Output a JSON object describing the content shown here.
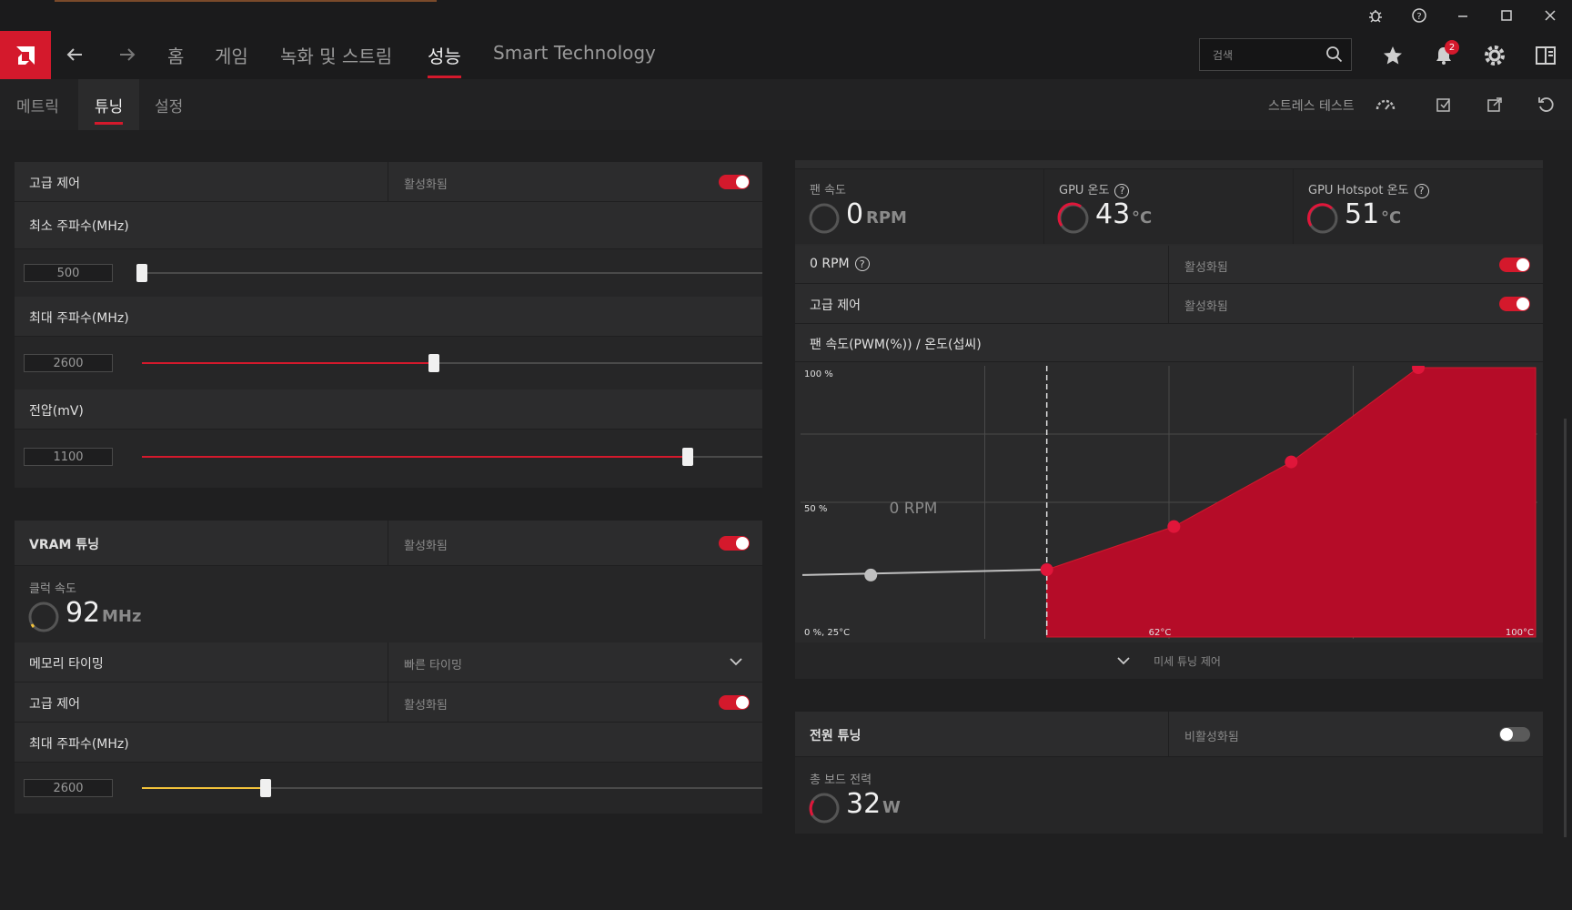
{
  "nav": {
    "home": "홈",
    "gaming": "게임",
    "record": "녹화 및 스트림",
    "performance": "성능",
    "smart": "Smart Technology",
    "search_placeholder": "검색",
    "notification_count": "2"
  },
  "subnav": {
    "metrics": "메트릭",
    "tuning": "튜닝",
    "settings": "설정",
    "stress_test": "스트레스 테스트"
  },
  "gpu_tuning": {
    "advanced_control": "고급 제어",
    "advanced_state": "활성화됨",
    "min_freq_label": "최소 주파수(MHz)",
    "min_freq_value": "500",
    "min_freq_fraction": 0.0,
    "max_freq_label": "최대 주파수(MHz)",
    "max_freq_value": "2600",
    "max_freq_fraction": 0.47,
    "voltage_label": "전압(mV)",
    "voltage_value": "1100",
    "voltage_fraction": 0.88
  },
  "vram": {
    "title": "VRAM 튜닝",
    "state": "활성화됨",
    "clock_label": "클럭 속도",
    "clock_value": "92",
    "clock_unit": "MHz",
    "timing_label": "메모리 타이밍",
    "timing_value": "빠른 타이밍",
    "advanced_control": "고급 제어",
    "advanced_state": "활성화됨",
    "max_freq_label": "최대 주파수(MHz)",
    "max_freq_value": "2600",
    "max_freq_fraction": 0.2
  },
  "fan": {
    "speed_label": "팬 속도",
    "speed_value": "0",
    "speed_unit": "RPM",
    "gpu_temp_label": "GPU 온도",
    "gpu_temp_value": "43",
    "gpu_temp_unit": "°C",
    "hotspot_label": "GPU Hotspot 온도",
    "hotspot_value": "51",
    "hotspot_unit": "°C",
    "zero_rpm_label": "0 RPM",
    "zero_rpm_state": "활성화됨",
    "advanced_control": "고급 제어",
    "advanced_state": "활성화됨",
    "curve_title": "팬 속도(PWM(%)) / 온도(섭씨)",
    "fine_tune": "미세 튜닝 제어"
  },
  "chart_data": {
    "type": "area",
    "title": "팬 속도(PWM(%)) / 온도(섭씨)",
    "y_ticks": [
      "100 %",
      "50 %",
      "0 %, 25°C"
    ],
    "x_ticks": [
      "62°C",
      "100°C"
    ],
    "zero_rpm_label": "0 RPM",
    "x_range": [
      25,
      100
    ],
    "y_range": [
      0,
      100
    ],
    "grid": true,
    "gray_point": {
      "x": 32,
      "y": 23
    },
    "points": [
      {
        "x": 50,
        "y": 25
      },
      {
        "x": 63,
        "y": 41
      },
      {
        "x": 75,
        "y": 65
      },
      {
        "x": 88,
        "y": 100
      }
    ],
    "colors": {
      "fill": "#b50c28",
      "point": "#e0163a",
      "gray": "#c0c0c0"
    }
  },
  "power": {
    "title": "전원 튜닝",
    "state": "비활성화됨",
    "board_power_label": "총 보드 전력",
    "board_power_value": "32",
    "board_power_unit": "W"
  },
  "colors": {
    "accent": "#d4192c",
    "vram_accent": "#f2c23a"
  }
}
